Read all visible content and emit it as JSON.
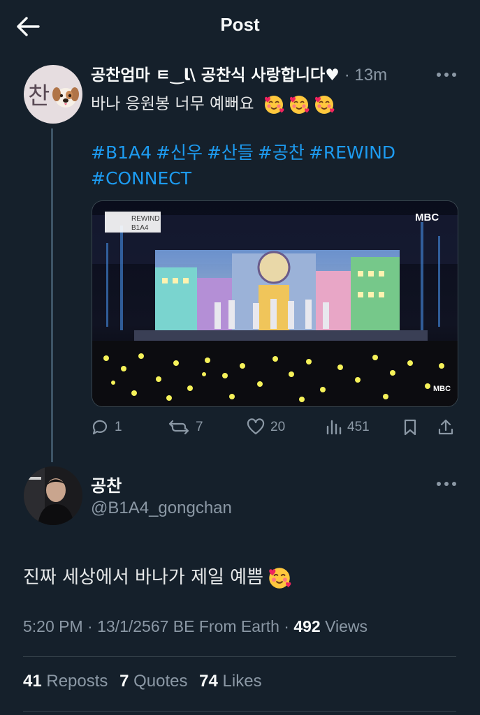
{
  "header": {
    "title": "Post"
  },
  "reply_tweet": {
    "display_name": "공찬엄마 ㅌ‿ﺎ\\ 공찬식 사랑합니다",
    "heart": "♥",
    "time": "· 13m",
    "text": "바나 응원봉 너무 예뻐요",
    "hashtags": [
      "#B1A4",
      "#신우",
      "#산들",
      "#공찬",
      "#REWIND",
      "#CONNECT"
    ],
    "media": {
      "badge_top": "REWIND",
      "badge_bottom": "B1A4",
      "network_logo": "MBC",
      "corner_logo": "MBC"
    },
    "actions": {
      "replies": "1",
      "reposts": "7",
      "likes": "20",
      "views": "451"
    }
  },
  "main_tweet": {
    "display_name": "공찬",
    "handle": "@B1A4_gongchan",
    "text": "진짜 세상에서 바나가 제일 예쁨",
    "timestamp": "5:20 PM · 13/1/2567 BE From Earth · ",
    "views_count": "492",
    "views_label": " Views",
    "reposts_count": "41",
    "reposts_label": " Reposts",
    "quotes_count": "7",
    "quotes_label": " Quotes",
    "likes_count": "74",
    "likes_label": " Likes"
  },
  "colors": {
    "background": "#15202b",
    "link": "#1d9bf0",
    "muted": "#8b98a5",
    "text": "#e7e9ea"
  },
  "icons": [
    "back-arrow-icon",
    "more-icon",
    "reply-icon",
    "repost-icon",
    "like-icon",
    "views-icon",
    "bookmark-icon",
    "share-icon"
  ]
}
